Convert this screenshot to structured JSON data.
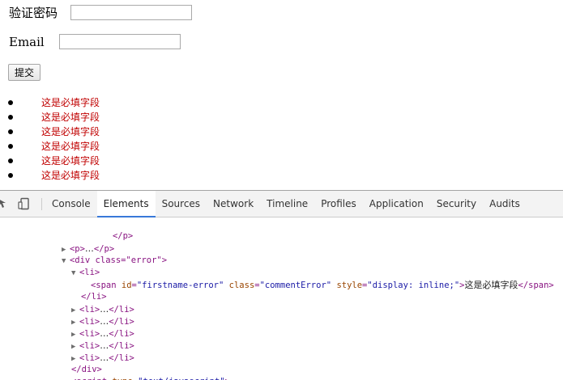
{
  "form": {
    "password_verify_label": "验证密码",
    "email_label": "Email",
    "submit_label": "提交"
  },
  "errors": {
    "items": [
      "这是必填字段",
      "这是必填字段",
      "这是必填字段",
      "这是必填字段",
      "这是必填字段",
      "这是必填字段"
    ],
    "color": "#c00000"
  },
  "devtools": {
    "tabs": [
      "Console",
      "Elements",
      "Sources",
      "Network",
      "Timeline",
      "Profiles",
      "Application",
      "Security",
      "Audits"
    ],
    "active_tab": "Elements",
    "accent_color": "#3879d9",
    "tree": [
      {
        "collapsed": "",
        "open": "",
        "close": "</p>"
      },
      {
        "collapsed": "▶",
        "open": "<p>",
        "ellipsis": "…",
        "close": "</p>"
      },
      {
        "collapsed": "▼",
        "open": "<div class=\"error\">"
      },
      {
        "collapsed": "▼",
        "open": "<li>"
      },
      {
        "span_open": "<span",
        "id_attr": "id",
        "id_val": "\"firstname-error\"",
        "class_attr": "class",
        "class_val": "\"commentError\"",
        "style_attr": "style",
        "style_val": "\"display: inline;\"",
        "text": "这是必填字段",
        "span_close": "</span>"
      },
      {
        "open": "</li>"
      },
      {
        "collapsed": "▶",
        "open": "<li>",
        "ellipsis": "…",
        "close": "</li>"
      },
      {
        "collapsed": "▶",
        "open": "<li>",
        "ellipsis": "…",
        "close": "</li>"
      },
      {
        "collapsed": "▶",
        "open": "<li>",
        "ellipsis": "…",
        "close": "</li>"
      },
      {
        "collapsed": "▶",
        "open": "<li>",
        "ellipsis": "…",
        "close": "</li>"
      },
      {
        "collapsed": "▶",
        "open": "<li>",
        "ellipsis": "…",
        "close": "</li>"
      },
      {
        "open": "</div>"
      },
      {
        "open": "<script",
        "type_attr": "type",
        "type_val": "\"text/javascript\"",
        "close": ">"
      }
    ]
  }
}
